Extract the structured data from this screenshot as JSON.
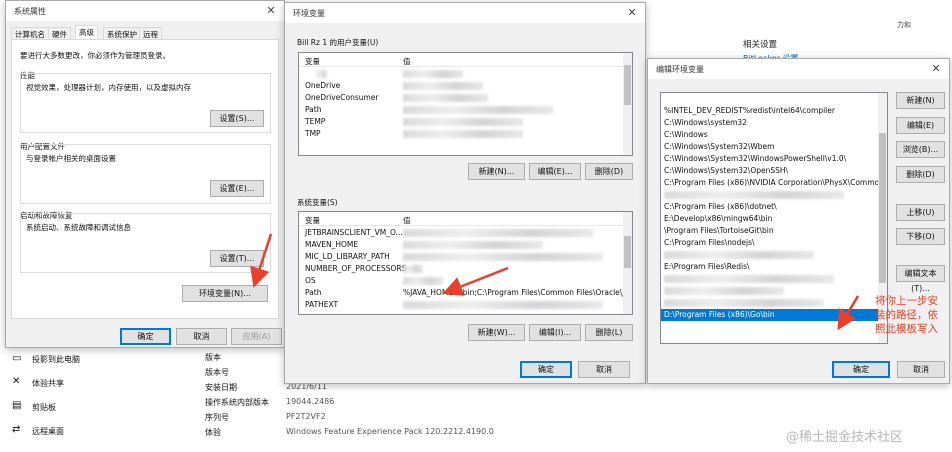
{
  "background_settings": {
    "related_heading": "相关设置",
    "bitlocker_link": "BitLocker 设置",
    "side_items": [
      {
        "label": "投影到此电脑",
        "icon": "project-icon"
      },
      {
        "label": "体验共享",
        "icon": "share-icon"
      },
      {
        "label": "剪贴板",
        "icon": "clipboard-icon"
      },
      {
        "label": "远程桌面",
        "icon": "remote-desktop-icon"
      }
    ],
    "spec_rows": [
      {
        "label": "版本",
        "value": ""
      },
      {
        "label": "版本号",
        "value": ""
      },
      {
        "label": "安装日期",
        "value": "2021/6/11"
      },
      {
        "label": "操作系统内部版本",
        "value": "19044.2486"
      },
      {
        "label": "序列号",
        "value": "PF2T2VF2"
      },
      {
        "label": "体验",
        "value": "Windows Feature Experience Pack 120.2212.4190.0"
      }
    ],
    "right_edge_text": "力和",
    "watermark": "@稀土掘金技术社区"
  },
  "sys_props": {
    "title": "系统属性",
    "tabs": [
      "计算机名",
      "硬件",
      "高级",
      "系统保护",
      "远程"
    ],
    "active_tab": "高级",
    "admin_note": "要进行大多数更改，你必须作为管理员登录。",
    "perf": {
      "title": "性能",
      "desc": "视觉效果，处理器计划，内存使用，以及虚拟内存",
      "button": "设置(S)..."
    },
    "profile": {
      "title": "用户配置文件",
      "desc": "与登录帐户相关的桌面设置",
      "button": "设置(E)..."
    },
    "startup": {
      "title": "启动和故障恢复",
      "desc": "系统启动、系统故障和调试信息",
      "button": "设置(T)..."
    },
    "env_button": "环境变量(N)...",
    "ok": "确定",
    "cancel": "取消",
    "apply": "应用(A)"
  },
  "env_vars": {
    "title": "环境变量",
    "user_group": "Bill Rz 1 的用户变量(U)",
    "col_var": "变量",
    "col_val": "值",
    "user_rows": [
      {
        "name": "",
        "value": ""
      },
      {
        "name": "OneDrive",
        "value": ""
      },
      {
        "name": "OneDriveConsumer",
        "value": ""
      },
      {
        "name": "Path",
        "value": ""
      },
      {
        "name": "TEMP",
        "value": ""
      },
      {
        "name": "TMP",
        "value": ""
      }
    ],
    "user_new": "新建(N)...",
    "user_edit": "编辑(E)...",
    "user_delete": "删除(D)",
    "sys_group": "系统变量(S)",
    "sys_rows": [
      {
        "name": "JETBRAINSCLIENT_VM_O...",
        "value": ""
      },
      {
        "name": "MAVEN_HOME",
        "value": ""
      },
      {
        "name": "MIC_LD_LIBRARY_PATH",
        "value": ""
      },
      {
        "name": "NUMBER_OF_PROCESSORS",
        "value": ""
      },
      {
        "name": "OS",
        "value": ""
      },
      {
        "name": "Path",
        "value": "%JAVA_HOME%\\bin;C:\\Program Files\\Common Files\\Oracle\\J..."
      },
      {
        "name": "PATHEXT",
        "value": ""
      }
    ],
    "sys_new": "新建(W)...",
    "sys_edit": "编辑(I)...",
    "sys_delete": "删除(L)",
    "ok": "确定",
    "cancel": "取消"
  },
  "edit_env": {
    "title": "编辑环境变量",
    "paths": [
      "%INTEL_DEV_REDIST%redist\\intel64\\compiler",
      "C:\\Windows\\system32",
      "C:\\Windows",
      "C:\\Windows\\System32\\Wbem",
      "C:\\Windows\\System32\\WindowsPowerShell\\v1.0\\",
      "C:\\Windows\\System32\\OpenSSH\\",
      "C:\\Program Files (x86)\\NVIDIA Corporation\\PhysX\\Common",
      "",
      "C:\\Program Files (x86)\\dotnet\\",
      "E:\\Develop\\x86\\mingw64\\bin",
      "\\Program Files\\TortoiseGit\\bin",
      "C:\\Program Files\\nodejs\\",
      "",
      "E:\\Program Files\\Redis\\",
      "",
      "",
      "",
      "D:\\Program Files (x86)\\Go\\bin"
    ],
    "selected_index": 17,
    "buttons": [
      "新建(N)",
      "编辑(E)",
      "浏览(B)...",
      "删除(D)",
      "上移(U)",
      "下移(O)",
      "编辑文本(T)..."
    ],
    "ok": "确定",
    "cancel": "取消",
    "annotation": "将你上一步安装的路径，依照此模板写入"
  },
  "colors": {
    "accent": "#0078d7",
    "annotation": "#e8402a",
    "arrow": "#e8402a"
  }
}
